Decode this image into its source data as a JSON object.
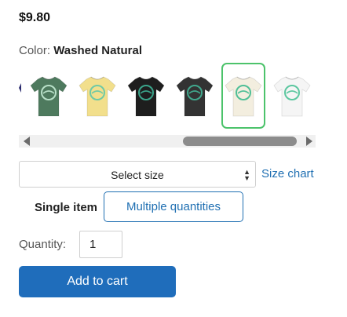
{
  "price": "$9.80",
  "color": {
    "label": "Color:",
    "value": "Washed Natural"
  },
  "swatches": [
    {
      "name": "green",
      "shirt": "#4e7a5e",
      "logo": "#b8e0c8",
      "selected": false
    },
    {
      "name": "yellow",
      "shirt": "#f2df8c",
      "logo": "#6ec9a6",
      "selected": false
    },
    {
      "name": "black",
      "shirt": "#1e1e1e",
      "logo": "#3aa48a",
      "selected": false
    },
    {
      "name": "charcoal",
      "shirt": "#333333",
      "logo": "#41a88d",
      "selected": false
    },
    {
      "name": "washed-natural",
      "shirt": "#f3eedf",
      "logo": "#4fbf97",
      "selected": true
    },
    {
      "name": "white",
      "shirt": "#f5f5f5",
      "logo": "#5cc7a0",
      "selected": false
    }
  ],
  "size": {
    "selected": "Select size",
    "chart_link": "Size chart"
  },
  "purchase_mode": {
    "single": "Single item",
    "multiple": "Multiple quantities"
  },
  "quantity": {
    "label": "Quantity:",
    "value": "1"
  },
  "add_to_cart": "Add to cart",
  "colors": {
    "link": "#1f6fb2",
    "primary": "#1f6dbb",
    "selected_border": "#4cc36b"
  }
}
